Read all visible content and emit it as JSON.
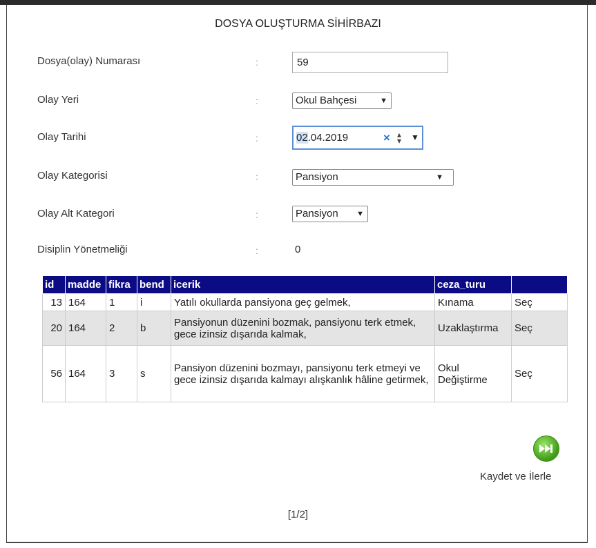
{
  "title": "DOSYA OLUŞTURMA SİHİRBAZI",
  "separator": ":",
  "fields": {
    "file_number": {
      "label": "Dosya(olay) Numarası",
      "value": "59"
    },
    "event_place": {
      "label": "Olay Yeri",
      "value": "Okul Bahçesi",
      "arrow": "▼"
    },
    "event_date": {
      "label": "Olay Tarihi",
      "value_day": "02",
      "value_rest": ".04.2019",
      "clear": "×",
      "spin": "⇕",
      "arrow": "▼"
    },
    "event_category": {
      "label": "Olay Kategorisi",
      "value": "Pansiyon",
      "arrow": "▼"
    },
    "event_subcategory": {
      "label": "Olay Alt Kategori",
      "value": "Pansiyon",
      "arrow": "▼"
    },
    "regulation": {
      "label": "Disiplin Yönetmeliği",
      "value": "0"
    }
  },
  "table": {
    "headers": [
      "id",
      "madde",
      "fikra",
      "bend",
      "icerik",
      "ceza_turu",
      ""
    ],
    "rows": [
      {
        "id": "13",
        "madde": "164",
        "fikra": "1",
        "bend": "i",
        "icerik": "Yatılı okullarda pansiyona geç gelmek,",
        "ceza_turu": "Kınama",
        "action": "Seç"
      },
      {
        "id": "20",
        "madde": "164",
        "fikra": "2",
        "bend": "b",
        "icerik": "Pansiyonun düzenini bozmak, pansiyonu terk etmek, gece izinsiz dışarıda kalmak,",
        "ceza_turu": "Uzaklaştırma",
        "action": "Seç"
      },
      {
        "id": "56",
        "madde": "164",
        "fikra": "3",
        "bend": "s",
        "icerik": "Pansiyon düzenini bozmayı, pansiyonu terk etmeyi ve gece izinsiz dışarıda kalmayı alışkanlık hâline getirmek,",
        "ceza_turu": "Okul Değiştirme",
        "action": "Seç"
      }
    ]
  },
  "save_button": {
    "label": "Kaydet ve İlerle",
    "icon": "fast-forward-icon",
    "color": "#4aa81f"
  },
  "pager": "[1/2]",
  "colors": {
    "header_bg": "#0b0b86",
    "stripe": "#e4e4e4",
    "focus": "#5b8fd6"
  }
}
